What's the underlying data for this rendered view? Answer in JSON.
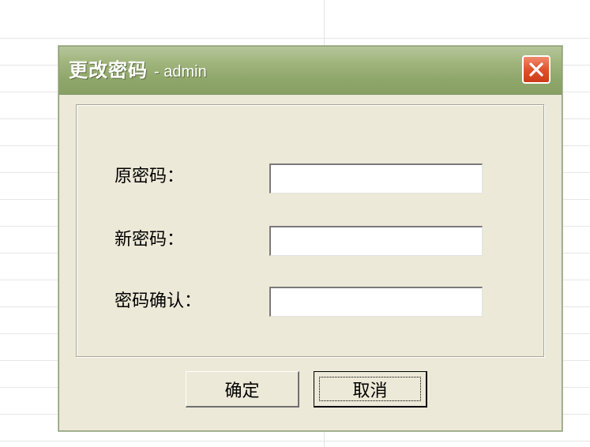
{
  "dialog": {
    "title_main": "更改密码",
    "title_sub": "- admin",
    "close_icon": "close-icon",
    "close_color": "#e0532e"
  },
  "form": {
    "old_password_label": "原密码：",
    "new_password_label": "新密码：",
    "confirm_password_label": "密码确认：",
    "old_password_value": "",
    "new_password_value": "",
    "confirm_password_value": ""
  },
  "buttons": {
    "ok_label": "确定",
    "cancel_label": "取消"
  }
}
